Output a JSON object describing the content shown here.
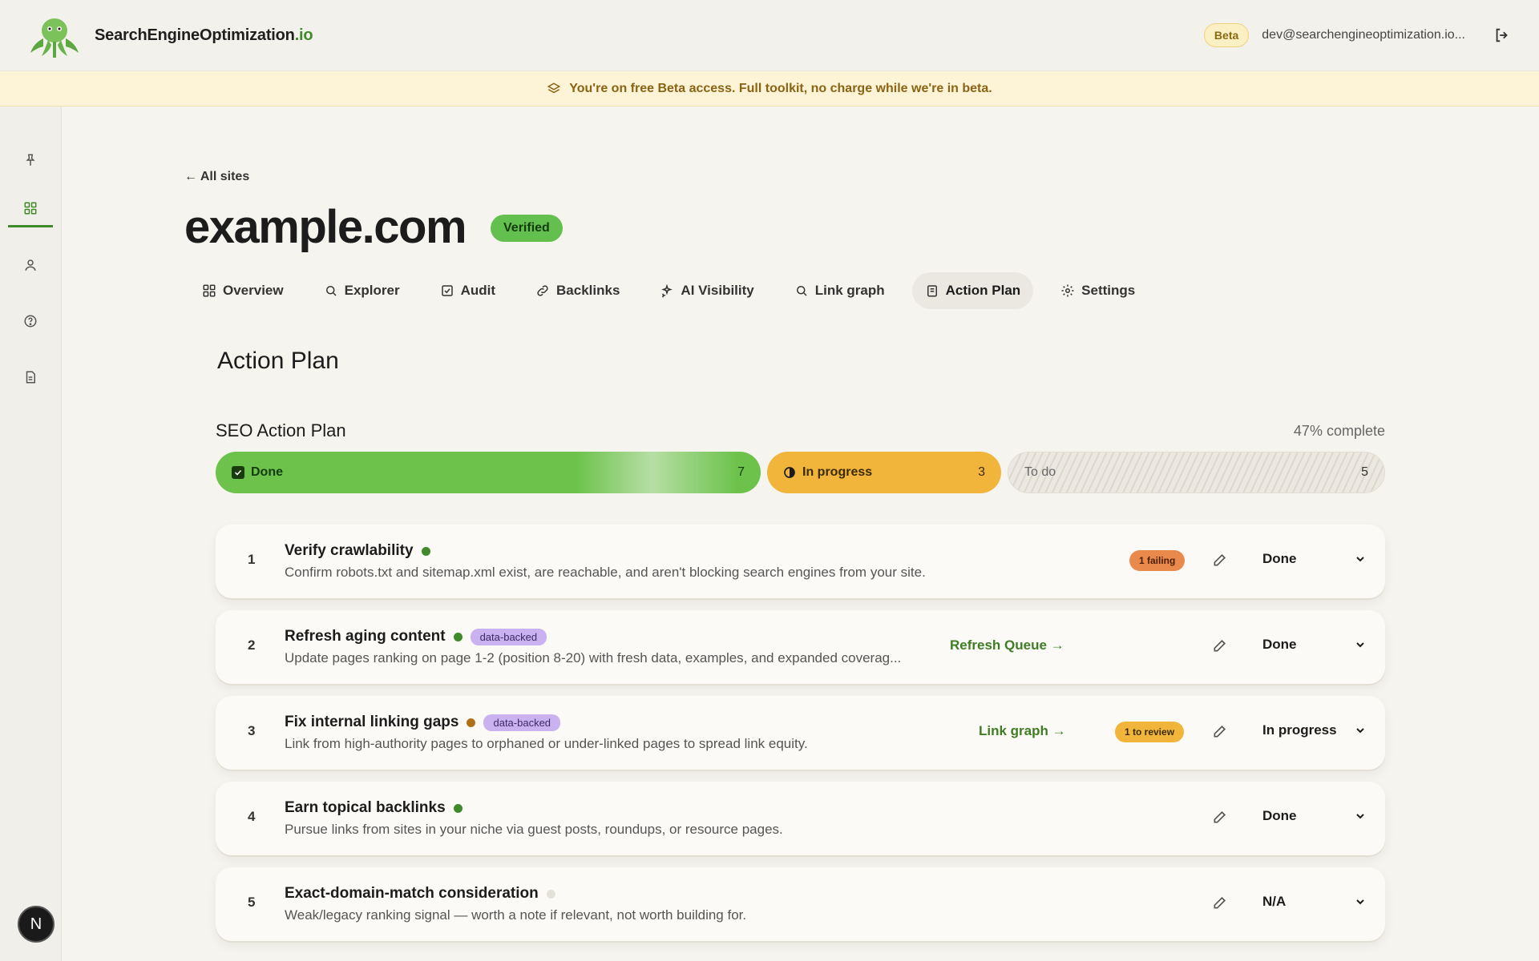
{
  "brand": {
    "name": "SearchEngineOptimization",
    "tld": ".io"
  },
  "header": {
    "beta_label": "Beta",
    "user_email": "dev@searchengineoptimization.io..."
  },
  "banner": {
    "text": "You're on free Beta access. Full toolkit, no charge while we're in beta."
  },
  "sidebar": {
    "items": [
      "pin-icon",
      "grid-icon",
      "user-icon",
      "help-icon",
      "doc-icon"
    ],
    "avatar_letter": "N"
  },
  "site": {
    "back_label": "← All sites",
    "title": "example.com",
    "status": "Verified"
  },
  "tabs": [
    {
      "label": "Overview"
    },
    {
      "label": "Explorer"
    },
    {
      "label": "Audit"
    },
    {
      "label": "Backlinks"
    },
    {
      "label": "AI Visibility"
    },
    {
      "label": "Link graph"
    },
    {
      "label": "Action Plan"
    },
    {
      "label": "Settings"
    }
  ],
  "main": {
    "section_title": "Action Plan"
  },
  "plan": {
    "title": "SEO Action Plan",
    "complete": "47% complete",
    "done_label": "Done",
    "done_count": "7",
    "progress_label": "In progress",
    "progress_count": "3",
    "todo_label": "To do",
    "todo_count": "5"
  },
  "tasks": [
    {
      "num": "1",
      "title": "Verify crawlability",
      "desc": "Confirm robots.txt and sitemap.xml exist, are reachable, and aren't blocking search engines from your site.",
      "badge": "1 failing",
      "status": "Done"
    },
    {
      "num": "2",
      "title": "Refresh aging content",
      "tag": "data-backed",
      "desc": "Update pages ranking on page 1-2 (position 8-20) with fresh data, examples, and expanded coverag...",
      "link": "Refresh Queue →",
      "status": "Done"
    },
    {
      "num": "3",
      "title": "Fix internal linking gaps",
      "tag": "data-backed",
      "desc": "Link from high-authority pages to orphaned or under-linked pages to spread link equity.",
      "link": "Link graph →",
      "badge": "1 to review",
      "status": "In progress"
    },
    {
      "num": "4",
      "title": "Earn topical backlinks",
      "desc": "Pursue links from sites in your niche via guest posts, roundups, or resource pages.",
      "status": "Done"
    },
    {
      "num": "5",
      "title": "Exact-domain-match consideration",
      "desc": "Weak/legacy ranking signal — worth a note if relevant, not worth building for.",
      "status": "N/A"
    }
  ],
  "colors": {
    "accent": "#3f8a2a",
    "done": "#6cc24a",
    "in_progress": "#f0b53a",
    "tag": "#c9b2ef"
  }
}
